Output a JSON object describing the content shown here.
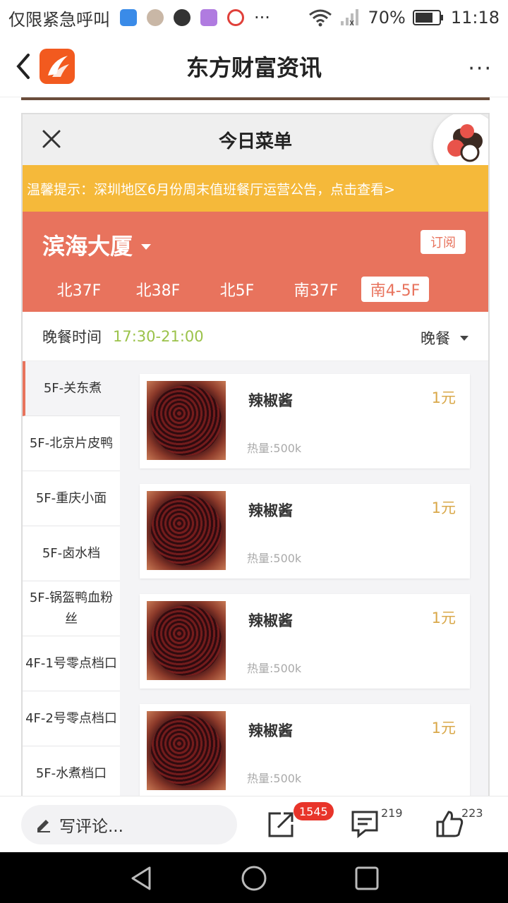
{
  "status_bar": {
    "carrier_text": "仅限紧急呼叫",
    "more": "···",
    "battery": "70%",
    "time": "11:18"
  },
  "app_bar": {
    "title": "东方财富资讯",
    "more": "···"
  },
  "mini_app": {
    "title": "今日菜单",
    "notice": "温馨提示：深圳地区6月份周末值班餐厅运营公告，点击查看>",
    "building": "滨海大厦",
    "subscribe_label": "订阅",
    "floors": [
      "北37F",
      "北38F",
      "北5F",
      "南37F",
      "南4-5F"
    ],
    "active_floor_index": 4,
    "meal_label": "晚餐时间",
    "meal_time": "17:30-21:00",
    "meal_select": "晚餐",
    "categories": [
      "5F-关东煮",
      "5F-北京片皮鸭",
      "5F-重庆小面",
      "5F-卤水档",
      "5F-锅盔鸭血粉丝",
      "4F-1号零点档口",
      "4F-2号零点档口",
      "5F-水煮档口"
    ],
    "active_category_index": 0,
    "dishes": [
      {
        "name": "辣椒酱",
        "price": "1元",
        "calories": "热量:500k"
      },
      {
        "name": "辣椒酱",
        "price": "1元",
        "calories": "热量:500k"
      },
      {
        "name": "辣椒酱",
        "price": "1元",
        "calories": "热量:500k"
      },
      {
        "name": "辣椒酱",
        "price": "1元",
        "calories": "热量:500k"
      }
    ]
  },
  "bottom_bar": {
    "comment_placeholder": "写评论...",
    "share_count": "1545",
    "comment_count": "219",
    "like_count": "223"
  },
  "colors": {
    "brand_orange": "#f25a1f",
    "notice_yellow": "#f5b93a",
    "header_coral": "#e8735d",
    "time_green": "#9bc24a",
    "price_gold": "#d9a84a",
    "badge_red": "#e8342a"
  }
}
